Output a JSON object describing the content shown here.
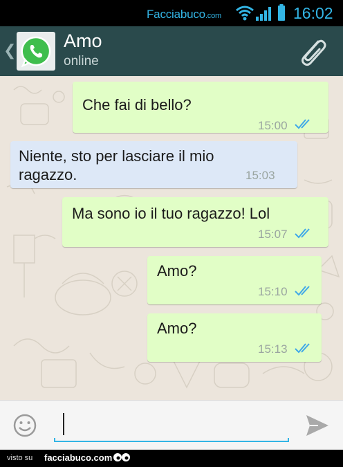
{
  "status_bar": {
    "brand": "Facciabuco",
    "brand_suffix": ".com",
    "time": "16:02"
  },
  "header": {
    "contact_name": "Amo",
    "contact_status": "online",
    "icons": [
      "back-chevron-icon",
      "whatsapp-avatar-icon",
      "paperclip-icon"
    ]
  },
  "messages": [
    {
      "direction": "out",
      "text": "Che fai di bello?",
      "time": "15:00",
      "ticks": "double-blue"
    },
    {
      "direction": "in",
      "text_line1": "Niente, sto per lasciare il mio",
      "text_line2": "ragazzo.",
      "time": "15:03"
    },
    {
      "direction": "out",
      "text": "Ma sono io il tuo ragazzo! Lol",
      "time": "15:07",
      "ticks": "double-blue"
    },
    {
      "direction": "out",
      "text": "Amo?",
      "time": "15:10",
      "ticks": "double-blue"
    },
    {
      "direction": "out",
      "text": "Amo?",
      "time": "15:13",
      "ticks": "double-blue"
    }
  ],
  "composer": {
    "value": "",
    "icons": [
      "emoji-icon",
      "send-icon"
    ]
  },
  "footer": {
    "prefix": "visto su",
    "site": "facciabuco.com"
  },
  "colors": {
    "header_bg": "#2a4a4c",
    "chat_bg": "#ece5dc",
    "outgoing_bubble": "#e1fec6",
    "incoming_bubble": "#dde8f7",
    "accent": "#33b5e5",
    "tick_blue": "#3fa8e8"
  }
}
